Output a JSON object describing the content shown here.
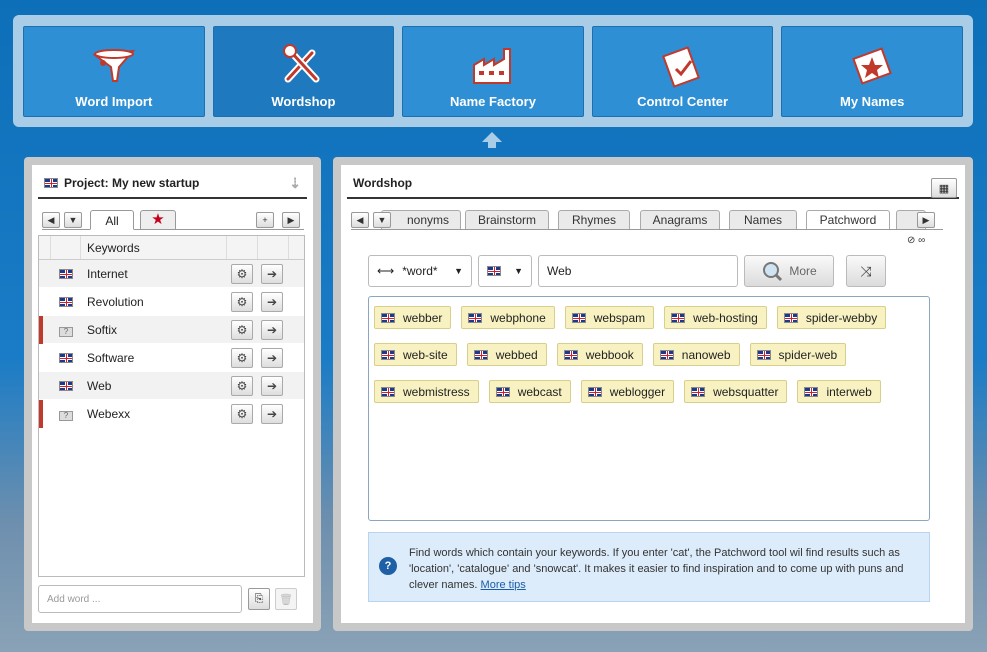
{
  "nav": {
    "items": [
      {
        "label": "Word Import",
        "icon": "funnel-icon"
      },
      {
        "label": "Wordshop",
        "icon": "tools-icon"
      },
      {
        "label": "Name Factory",
        "icon": "factory-icon"
      },
      {
        "label": "Control Center",
        "icon": "clipboard-icon"
      },
      {
        "label": "My Names",
        "icon": "book-icon"
      }
    ],
    "active": "Wordshop"
  },
  "project": {
    "title": "Project: My new startup",
    "tab_all": "All",
    "column_header": "Keywords",
    "keywords": [
      {
        "name": "Internet",
        "lang": "uk",
        "flagged": false
      },
      {
        "name": "Revolution",
        "lang": "uk",
        "flagged": false
      },
      {
        "name": "Softix",
        "lang": "unknown",
        "flagged": true
      },
      {
        "name": "Software",
        "lang": "uk",
        "flagged": false
      },
      {
        "name": "Web",
        "lang": "uk",
        "flagged": false
      },
      {
        "name": "Webexx",
        "lang": "unknown",
        "flagged": true
      }
    ],
    "add_placeholder": "Add word ..."
  },
  "wordshop": {
    "title": "Wordshop",
    "tabs": [
      "Synonyms",
      "Brainstorm",
      "Rhymes",
      "Anagrams",
      "Names",
      "Patchword"
    ],
    "tab_first_visible": "nonyms",
    "active_tab": "Patchword",
    "settings_text": "∞",
    "mode_select": "*word*",
    "word_value": "Web",
    "more_label": "More",
    "results": [
      [
        "webber",
        "webphone",
        "webspam",
        "web-hosting",
        "spider-webby"
      ],
      [
        "web-site",
        "webbed",
        "webbook",
        "nanoweb",
        "spider-web"
      ],
      [
        "webmistress",
        "webcast",
        "weblogger",
        "websquatter",
        "interweb"
      ]
    ],
    "tip_text": "Find words which contain your keywords. If you enter 'cat', the Patchword tool wil find results such as 'location', 'catalogue' and 'snowcat'. It makes it easier to find inspiration and to come up with puns and clever names.",
    "tip_link": "More tips"
  }
}
